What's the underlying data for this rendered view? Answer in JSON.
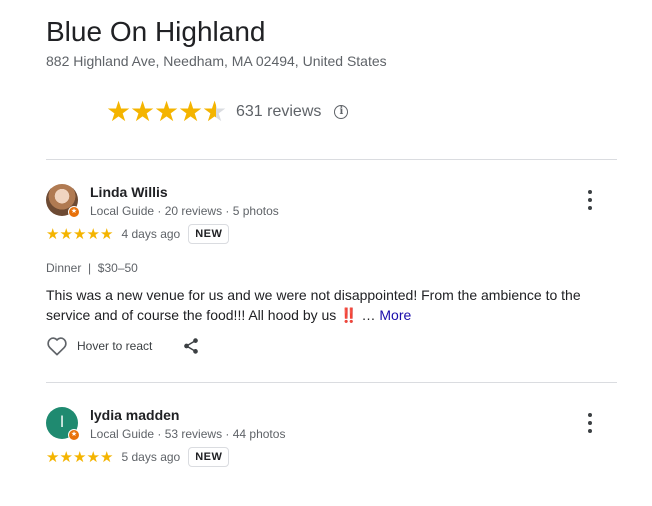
{
  "place": {
    "name": "Blue On Highland",
    "address": "882 Highland Ave, Needham, MA 02494, United States",
    "rating": 4.6,
    "reviews_label": "631 reviews"
  },
  "reviews": [
    {
      "author": "Linda Willis",
      "meta": "Local Guide · 20 reviews · 5 photos",
      "stars": "★★★★★",
      "date": "4 days ago",
      "new_label": "NEW",
      "dinner": "Dinner  |  $30–50",
      "text": "This was a new venue for us and we were not disappointed! From the ambience to the service and of course the food!!! All hood by us ‼️ … ",
      "more_label": "More",
      "react_label": "Hover to react"
    },
    {
      "author": "lydia madden",
      "avatar_letter": "l",
      "meta": "Local Guide · 53 reviews · 44 photos",
      "stars": "★★★★★",
      "date": "5 days ago",
      "new_label": "NEW"
    }
  ],
  "colors": {
    "star": "#f4b400",
    "avatar2": "#1f8a70",
    "badge": "#e8710a",
    "link": "#1a0dab"
  }
}
